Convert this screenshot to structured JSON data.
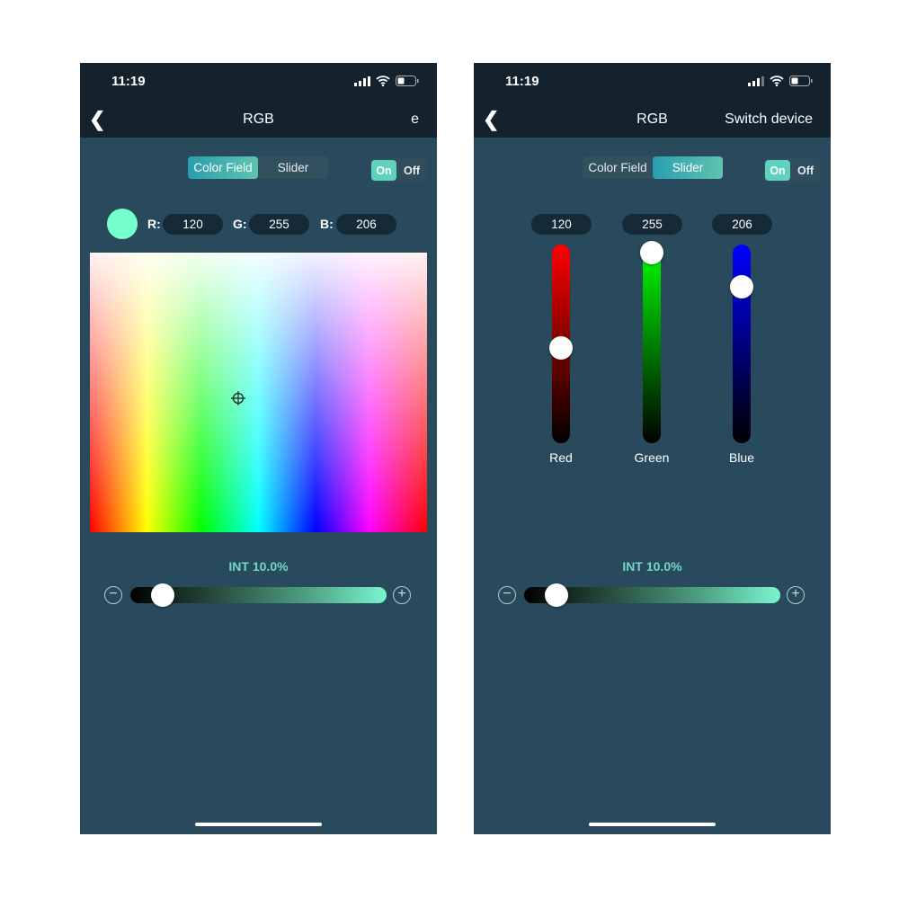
{
  "status_bar": {
    "time": "11:19"
  },
  "header": {
    "title": "RGB",
    "switch_label": "Switch device",
    "switch_label_partial": "e"
  },
  "mode_tabs": [
    "Color Field",
    "Slider"
  ],
  "power": {
    "on": "On",
    "off": "Off",
    "state": "On"
  },
  "color": {
    "hex": "#78ffce",
    "r_label": "R:",
    "g_label": "G:",
    "b_label": "B:",
    "r": "120",
    "g": "255",
    "b": "206"
  },
  "sliders": {
    "red_label": "Red",
    "green_label": "Green",
    "blue_label": "Blue"
  },
  "intensity": {
    "label": "INT  10.0%",
    "value_percent": 10.0
  },
  "icons": [
    "back-chevron-icon",
    "signal-icon",
    "wifi-icon",
    "battery-icon",
    "crosshair-icon",
    "minus-icon",
    "plus-icon"
  ]
}
